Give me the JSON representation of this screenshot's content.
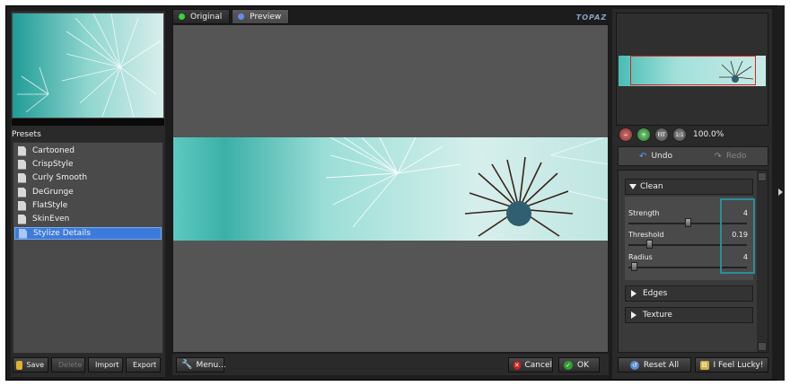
{
  "presets": {
    "header": "Presets",
    "items": [
      "Cartooned",
      "CrispStyle",
      "Curly Smooth",
      "DeGrunge",
      "FlatStyle",
      "SkinEven",
      "Stylize Details"
    ],
    "selected_index": 6
  },
  "preset_buttons": {
    "save": "Save",
    "delete": "Delete",
    "import": "Import",
    "export": "Export"
  },
  "tabs": {
    "original": "Original",
    "preview": "Preview"
  },
  "logo_text": "TOPAZ",
  "bottom": {
    "menu": "Menu...",
    "cancel": "Cancel",
    "ok": "OK"
  },
  "zoom": {
    "value": "100.0%",
    "fit_label": "FIT",
    "one_to_one_label": "1:1"
  },
  "history": {
    "undo": "Undo",
    "redo": "Redo"
  },
  "settings": {
    "clean": {
      "title": "Clean",
      "params": [
        {
          "label": "Strength",
          "value": "4",
          "fraction": 0.5
        },
        {
          "label": "Threshold",
          "value": "0.19",
          "fraction": 0.16
        },
        {
          "label": "Radius",
          "value": "4",
          "fraction": 0.02
        }
      ]
    },
    "edges": "Edges",
    "texture": "Texture"
  },
  "right_buttons": {
    "reset_all": "Reset All",
    "lucky": "I Feel Lucky!"
  },
  "colors": {
    "selection": "#3c7bdc",
    "highlight": "#2a8f9a",
    "nav_rect": "#e02020"
  }
}
